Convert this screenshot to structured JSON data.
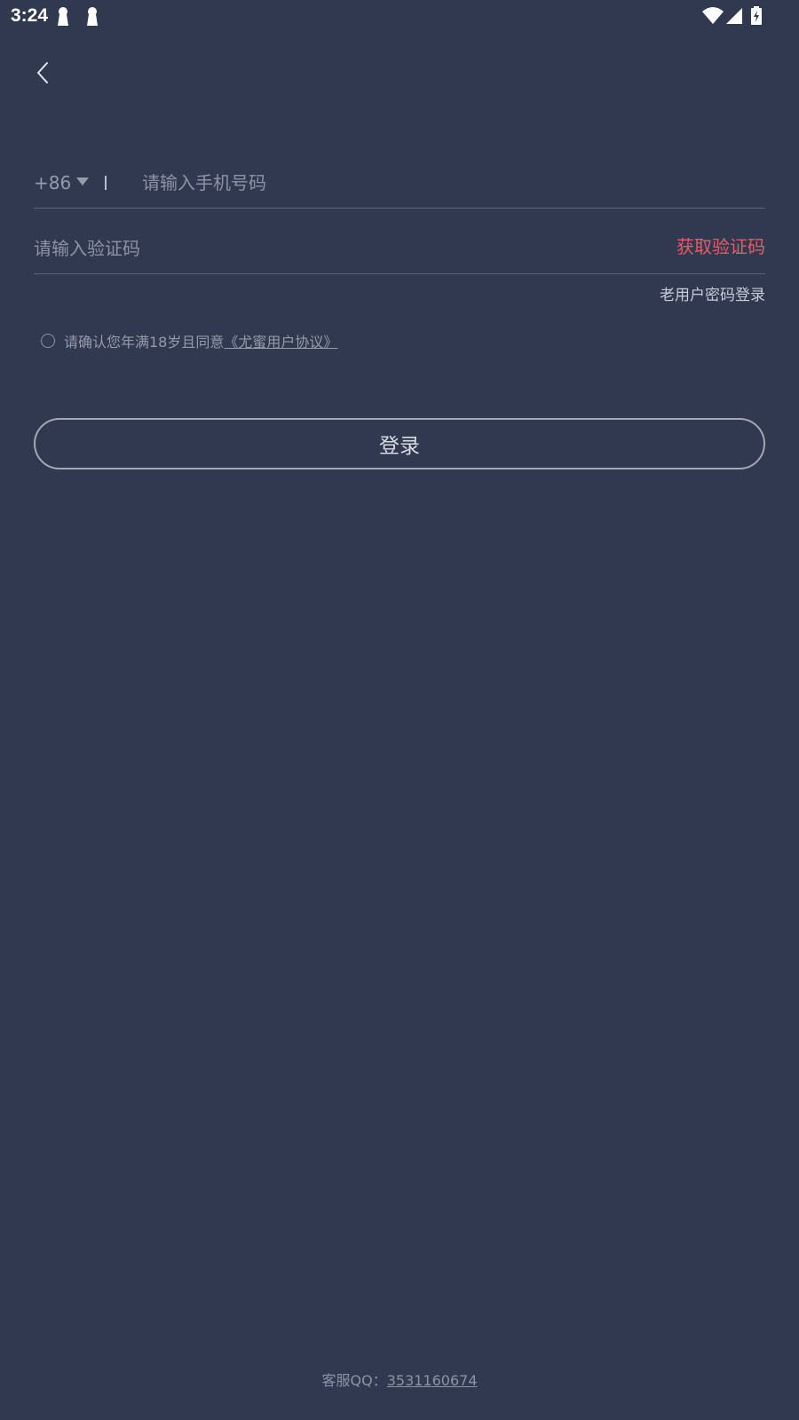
{
  "status_bar": {
    "time": "3:24"
  },
  "phone": {
    "country_code": "+86",
    "placeholder": "请输入手机号码"
  },
  "verification": {
    "placeholder": "请输入验证码",
    "get_code_label": "获取验证码"
  },
  "password_login_label": "老用户密码登录",
  "agreement": {
    "text": "请确认您年满18岁且同意",
    "link_label": "《尤蜜用户协议》"
  },
  "login_button_label": "登录",
  "footer": {
    "service_label": "客服QQ：",
    "qq_number": "3531160674"
  },
  "colors": {
    "background": "#313951",
    "accent_red": "#e95966",
    "divider": "#5a6178"
  }
}
